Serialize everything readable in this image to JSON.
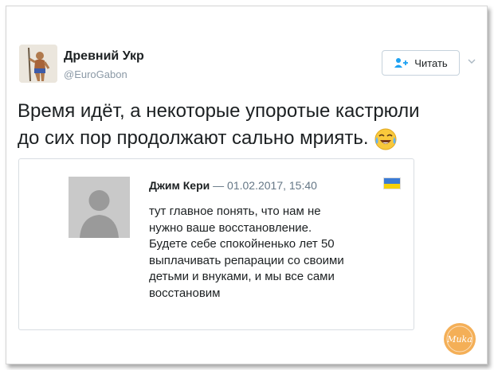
{
  "author": {
    "name": "Древний Укр",
    "handle": "@EuroGabon",
    "avatar_icon": "warrior-figure-avatar"
  },
  "follow_button": {
    "label": "Читать",
    "icon": "add-user-icon"
  },
  "tweet": {
    "lines": [
      "Время идёт, а некоторые упоротые кастрюли",
      "до сих пор продолжают сально мриять."
    ],
    "emoji": "face-with-tears-of-joy-icon"
  },
  "quote": {
    "author_name": "Джим Кери",
    "separator": "—",
    "date": "01.02.2017, 15:40",
    "flag": {
      "top": "#3a7bd5",
      "bottom": "#f5d10a"
    },
    "lines": [
      "тут главное понять, что нам не",
      "нужно ваше восстановление.",
      "Будете себе спокойненько лет 50",
      "выплачивать репарации со своими",
      "детьми и внуками, и мы все сами",
      "восстановим"
    ]
  },
  "watermark": {
    "text": "Muka"
  },
  "colors": {
    "accent": "#1da1f2",
    "text": "#1c2022",
    "muted": "#8b99a6"
  }
}
